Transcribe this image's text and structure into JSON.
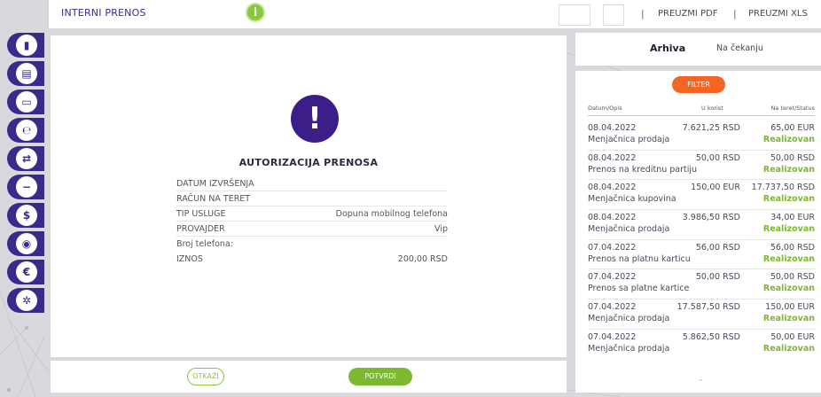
{
  "header": {
    "title": "INTERNI PRENOS",
    "info_icon": "info-icon",
    "separator": "|",
    "download_pdf": "PREUZMI PDF",
    "download_xls": "PREUZMI XLS"
  },
  "sidebar": {
    "items": [
      {
        "icon": "dashboard-icon",
        "glyph": "▮"
      },
      {
        "icon": "accounts-icon",
        "glyph": "▤"
      },
      {
        "icon": "card-icon",
        "glyph": "▭"
      },
      {
        "icon": "payments-icon",
        "glyph": "℮"
      },
      {
        "icon": "transfer-icon",
        "glyph": "⇄"
      },
      {
        "icon": "minus-icon",
        "glyph": "−"
      },
      {
        "icon": "dollar-icon",
        "glyph": "$"
      },
      {
        "icon": "location-icon",
        "glyph": "◉"
      },
      {
        "icon": "euro-icon",
        "glyph": "€"
      },
      {
        "icon": "settings-icon",
        "glyph": "✲"
      }
    ]
  },
  "auth": {
    "icon_glyph": "!",
    "title": "AUTORIZACIJA PRENOSA",
    "rows": [
      {
        "label": "DATUM IZVRŠENJA",
        "value": ""
      },
      {
        "label": "RAČUN NA TERET",
        "value": ""
      },
      {
        "label": "TIP USLUGE",
        "value": "Dopuna mobilnog telefona"
      },
      {
        "label": "PROVAJDER",
        "value": "Vip"
      },
      {
        "label": "Broj telefona:",
        "value": ""
      },
      {
        "label": "IZNOS",
        "value": "200,00 RSD"
      }
    ],
    "cancel_label": "OTKAŽI",
    "confirm_label": "POTVRDI"
  },
  "archive": {
    "tab_active": "Arhiva",
    "tab_pending": "Na čekanju",
    "filter_label": "FILTER",
    "columns": {
      "date_desc": "Datum/Opis",
      "credit": "U korist",
      "debit_status": "Na teret/Status"
    },
    "rows": [
      {
        "date": "08.04.2022",
        "credit": "7.621,25 RSD",
        "debit": "65,00 EUR",
        "desc": "Menjačnica prodaja",
        "status": "Realizovan"
      },
      {
        "date": "08.04.2022",
        "credit": "50,00 RSD",
        "debit": "50,00 RSD",
        "desc": "Prenos na kreditnu partiju",
        "status": "Realizovan"
      },
      {
        "date": "08.04.2022",
        "credit": "150,00 EUR",
        "debit": "17.737,50 RSD",
        "desc": "Menjačnica kupovina",
        "status": "Realizovan"
      },
      {
        "date": "08.04.2022",
        "credit": "3.986,50 RSD",
        "debit": "34,00 EUR",
        "desc": "Menjačnica prodaja",
        "status": "Realizovan"
      },
      {
        "date": "07.04.2022",
        "credit": "56,00 RSD",
        "debit": "56,00 RSD",
        "desc": "Prenos na platnu karticu",
        "status": "Realizovan"
      },
      {
        "date": "07.04.2022",
        "credit": "50,00 RSD",
        "debit": "50,00 RSD",
        "desc": "Prenos sa platne kartice",
        "status": "Realizovan"
      },
      {
        "date": "07.04.2022",
        "credit": "17.587,50 RSD",
        "debit": "150,00 EUR",
        "desc": "Menjačnica prodaja",
        "status": "Realizovan"
      },
      {
        "date": "07.04.2022",
        "credit": "5.862,50 RSD",
        "debit": "50,00 EUR",
        "desc": "Menjačnica prodaja",
        "status": "Realizovan"
      }
    ],
    "more_glyph": "⌄"
  },
  "colors": {
    "brand_purple": "#3b2a8c",
    "accent_green": "#7cb830",
    "filter_orange": "#f26522"
  }
}
